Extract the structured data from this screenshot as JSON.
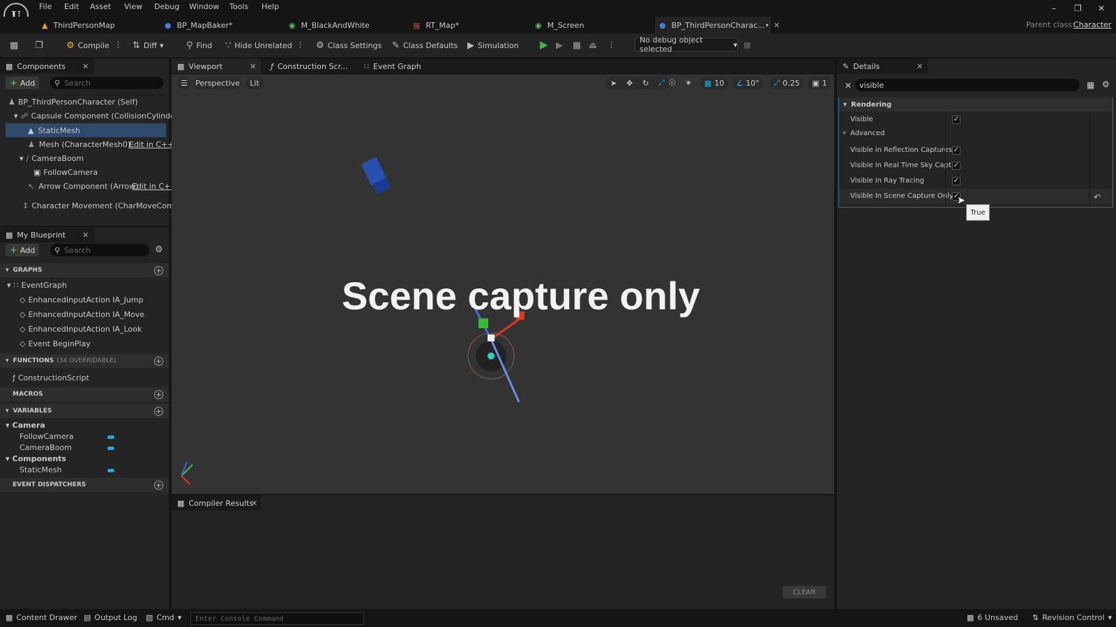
{
  "menu": [
    "File",
    "Edit",
    "Asset",
    "View",
    "Debug",
    "Window",
    "Tools",
    "Help"
  ],
  "tabs": [
    "ThirdPersonMap",
    "BP_MapBaker*",
    "M_BlackAndWhite",
    "RT_Map*",
    "M_Screen",
    "BP_ThirdPersonCharac...•"
  ],
  "parent_class": {
    "label": "Parent class:",
    "value": "Character"
  },
  "toolbar": {
    "compile": "Compile",
    "diff": "Diff",
    "find": "Find",
    "hide_unrelated": "Hide Unrelated",
    "class_settings": "Class Settings",
    "class_defaults": "Class Defaults",
    "simulation": "Simulation",
    "debug_object": "No debug object selected"
  },
  "components": {
    "tab": "Components",
    "add": "Add",
    "search_placeholder": "Search",
    "tree": [
      {
        "label": "BP_ThirdPersonCharacter (Self)"
      },
      {
        "label": "Capsule Component (CollisionCylinder)"
      },
      {
        "label": "StaticMesh"
      },
      {
        "label": "Mesh (CharacterMesh0)",
        "edit": "Edit in C++"
      },
      {
        "label": "CameraBoom"
      },
      {
        "label": "FollowCamera"
      },
      {
        "label": "Arrow Component (Arrow)",
        "edit": "Edit in C++"
      },
      {
        "label": "Character Movement (CharMoveComp)"
      }
    ]
  },
  "my_blueprint": {
    "tab": "My Blueprint",
    "add": "Add",
    "search_placeholder": "Search",
    "graphs_header": "GRAPHS",
    "event_graph": "EventGraph",
    "events": [
      "EnhancedInputAction IA_Jump",
      "EnhancedInputAction IA_Move",
      "EnhancedInputAction IA_Look",
      "Event BeginPlay"
    ],
    "functions_header": "FUNCTIONS",
    "functions_count": "(34 OVERRIDABLE)",
    "construction_script": "ConstructionScript",
    "macros_header": "MACROS",
    "variables_header": "VARIABLES",
    "camera_category": "Camera",
    "camera_vars": [
      "FollowCamera",
      "CameraBoom"
    ],
    "components_category": "Components",
    "components_vars": [
      "StaticMesh"
    ],
    "dispatchers_header": "EVENT DISPATCHERS"
  },
  "editor_tabs": {
    "viewport": "Viewport",
    "construction": "Construction Scr...",
    "event_graph": "Event Graph"
  },
  "viewport": {
    "perspective": "Perspective",
    "lit": "Lit",
    "grid_snap": "10",
    "rot_snap": "10°",
    "scale_snap": "0.25",
    "camera_speed": "1",
    "overlay_text": "Scene capture only"
  },
  "compiler": {
    "tab": "Compiler Results",
    "clear": "CLEAR"
  },
  "details": {
    "tab": "Details",
    "search_value": "visible",
    "category": "Rendering",
    "advanced": "Advanced",
    "props": [
      {
        "label": "Visible",
        "value": true
      },
      {
        "label": "Visible in Reflection Captures",
        "value": true
      },
      {
        "label": "Visible in Real Time Sky Capt...",
        "value": true
      },
      {
        "label": "Visible in Ray Tracing",
        "value": true
      },
      {
        "label": "Visible In Scene Capture Only",
        "value": true
      }
    ],
    "tooltip": "True"
  },
  "status": {
    "content_drawer": "Content Drawer",
    "output_log": "Output Log",
    "cmd": "Cmd",
    "console_placeholder": "Enter Console Command",
    "unsaved": "6 Unsaved",
    "revision_control": "Revision Control"
  },
  "colors": {
    "accent": "#20a8e8",
    "selected_row": "#2f4a6b",
    "panel": "#242424",
    "viewport": "#333333"
  }
}
